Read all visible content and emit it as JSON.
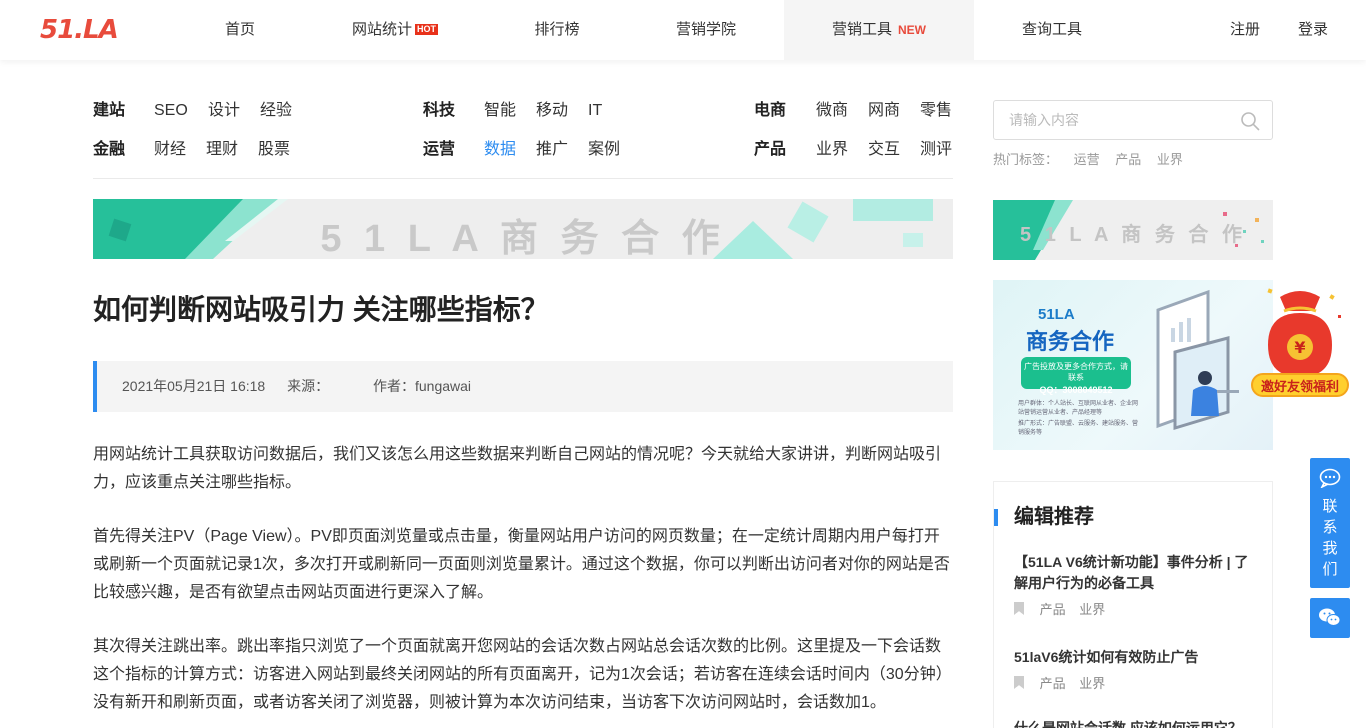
{
  "header": {
    "logo": "51.LA",
    "nav": [
      {
        "label": "首页"
      },
      {
        "label": "网站统计",
        "badge": "HOT"
      },
      {
        "label": "排行榜"
      },
      {
        "label": "营销学院"
      },
      {
        "label": "营销工具",
        "badge": "NEW"
      },
      {
        "label": "查询工具"
      }
    ],
    "register": "注册",
    "login": "登录"
  },
  "categories": {
    "groups": [
      {
        "head": "建站",
        "links": [
          "SEO",
          "设计",
          "经验"
        ]
      },
      {
        "head": "科技",
        "links": [
          "智能",
          "移动",
          "IT"
        ]
      },
      {
        "head": "电商",
        "links": [
          "微商",
          "网商",
          "零售"
        ]
      },
      {
        "head": "金融",
        "links": [
          "财经",
          "理财",
          "股票"
        ]
      },
      {
        "head": "运营",
        "links": [
          "数据",
          "推广",
          "案例"
        ]
      },
      {
        "head": "产品",
        "links": [
          "业界",
          "交互",
          "测评"
        ]
      }
    ],
    "active_link": "数据"
  },
  "banners": {
    "main_text": "5 1 L A 商 务 合 作",
    "side_text": "5 1 L A 商 务 合 作"
  },
  "article": {
    "title": "如何判断网站吸引力 关注哪些指标？",
    "date": "2021年05月21日 16:18",
    "source_label": "来源：",
    "author_label": "作者：fungawai",
    "paragraphs": [
      "用网站统计工具获取访问数据后，我们又该怎么用这些数据来判断自己网站的情况呢？今天就给大家讲讲，判断网站吸引力，应该重点关注哪些指标。",
      "首先得关注PV（Page View）。PV即页面浏览量或点击量，衡量网站用户访问的网页数量；在一定统计周期内用户每打开或刷新一个页面就记录1次，多次打开或刷新同一页面则浏览量累计。通过这个数据，你可以判断出访问者对你的网站是否比较感兴趣，是否有欲望点击网站页面进行更深入了解。",
      "其次得关注跳出率。跳出率指只浏览了一个页面就离开您网站的会话次数占网站总会话次数的比例。这里提及一下会话数这个指标的计算方式：访客进入网站到最终关闭网站的所有页面离开，记为1次会话；若访客在连续会话时间内（30分钟）没有新开和刷新页面，或者访客关闭了浏览器，则被计算为本次访问结束，当访客下次访问网站时，会话数加1。"
    ]
  },
  "sidebar": {
    "search_placeholder": "请输入内容",
    "hot_tags_label": "热门标签：",
    "hot_tags": [
      "运营",
      "产品",
      "业界"
    ],
    "ad": {
      "brand": "51LA",
      "title": "商务合作",
      "pill_line1": "广告投放及更多合作方式，请联系",
      "pill_line2": "QQ：3008049512",
      "fine1": "用户群体：个人站长、互联网从业者、企业网站营销运营从业者、产品经理等",
      "fine2": "推广形式：广告联盟、云服务、建站服务、营销服务等"
    },
    "envelope_label": "邀好友领福利",
    "envelope_symbol": "¥",
    "picks_title": "编辑推荐",
    "picks": [
      {
        "title": "【51LA V6统计新功能】事件分析 | 了解用户行为的必备工具",
        "tags": [
          "产品",
          "业界"
        ]
      },
      {
        "title": "51laV6统计如何有效防止广告",
        "tags": [
          "产品",
          "业界"
        ]
      },
      {
        "title": "什么是网站会话数 应该如何运用它？",
        "tags": []
      }
    ]
  },
  "floating": {
    "contact_chars": [
      "联",
      "系",
      "我",
      "们"
    ]
  },
  "colors": {
    "accent": "#2d8cf0",
    "brand_red": "#e84b3c",
    "teal": "#1bbf8e"
  }
}
